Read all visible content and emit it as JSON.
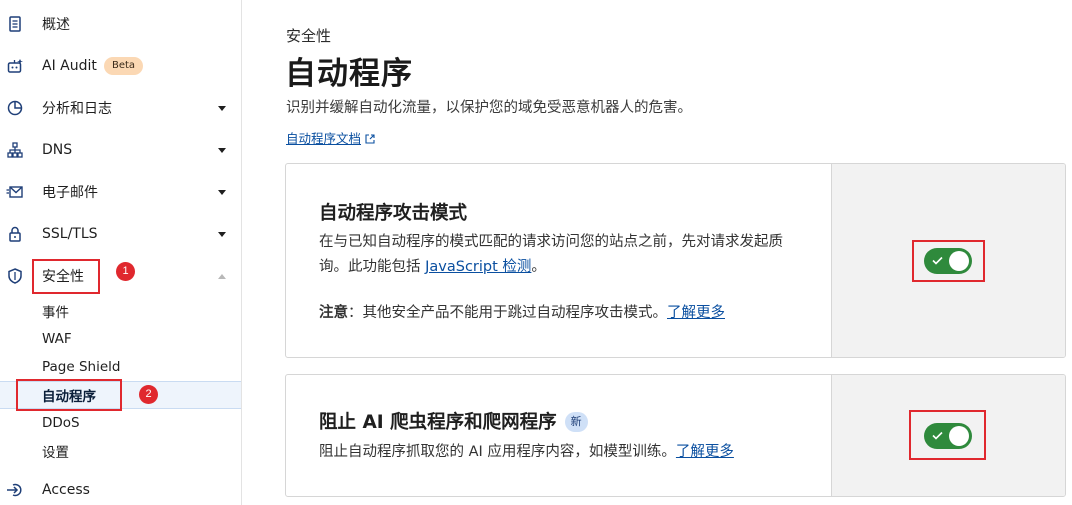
{
  "sidebar": {
    "items": [
      {
        "label": "概述",
        "icon": "document-icon"
      },
      {
        "label": "AI Audit",
        "icon": "robot-icon",
        "badge": "Beta"
      },
      {
        "label": "分析和日志",
        "icon": "pie-chart-icon"
      },
      {
        "label": "DNS",
        "icon": "network-icon"
      },
      {
        "label": "电子邮件",
        "icon": "email-icon"
      },
      {
        "label": "SSL/TLS",
        "icon": "lock-icon"
      },
      {
        "label": "安全性",
        "icon": "shield-icon"
      },
      {
        "label": "Access",
        "icon": "access-icon"
      }
    ],
    "subitems": [
      "事件",
      "WAF",
      "Page Shield",
      "自动程序",
      "DDoS",
      "设置"
    ]
  },
  "annotations": {
    "badge1": "1",
    "badge2": "2"
  },
  "main": {
    "section": "安全性",
    "title": "自动程序",
    "description": "识别并缓解自动化流量，以保护您的域免受恶意机器人的危害。",
    "docs_link": "自动程序文档"
  },
  "cards": [
    {
      "title": "自动程序攻击模式",
      "desc_part1": "在与已知自动程序的模式匹配的请求访问您的站点之前，先对请求发起质询。此功能包括 ",
      "desc_link": "JavaScript 检测",
      "desc_part2": "。",
      "note_label": "注意",
      "note_text": "：其他安全产品不能用于跳过自动程序攻击模式。",
      "learn_more": "了解更多",
      "toggle_on": true
    },
    {
      "title": "阻止 AI 爬虫程序和爬网程序",
      "badge": "新",
      "desc": "阻止自动程序抓取您的 AI 应用程序内容，如模型训练。",
      "learn_more": "了解更多",
      "toggle_on": true
    }
  ],
  "colors": {
    "accent": "#0a4fa0",
    "toggle_on": "#2f8a3c",
    "highlight": "#e0282e",
    "beta": "#fbd8b4"
  }
}
